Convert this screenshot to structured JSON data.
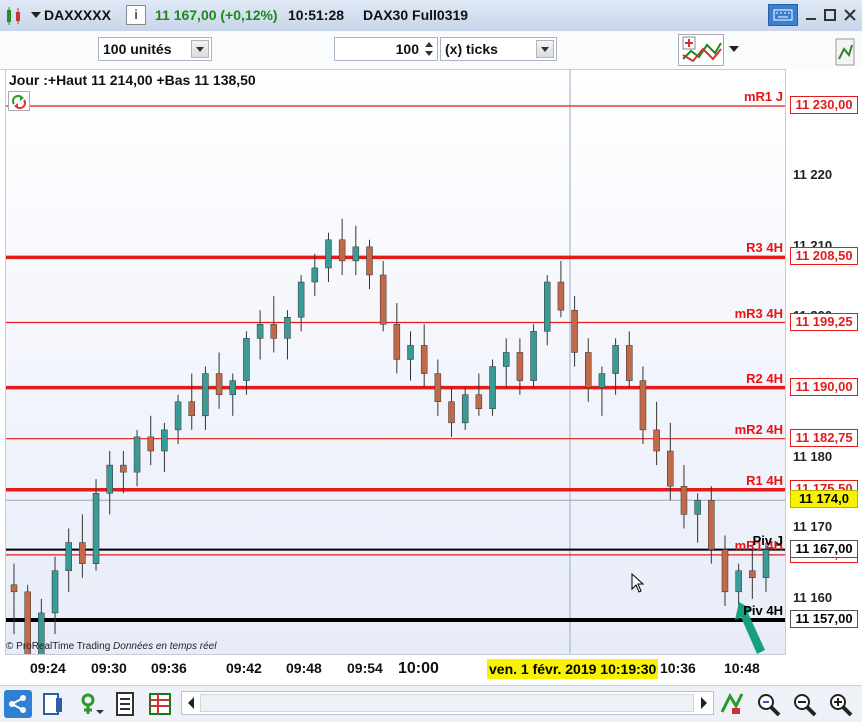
{
  "titlebar": {
    "instrument": "DAXXXXX",
    "info_icon": "i",
    "last_price": "11 167,00 (+0,12%)",
    "time": "10:51:28",
    "contract": "DAX30 Full0319"
  },
  "toolbar": {
    "units_value": "100 unités",
    "ticks_value": "100",
    "ticks_unit": "(x) ticks"
  },
  "chart": {
    "header": "Jour :+Haut 11 214,00 +Bas 11 138,50",
    "copyright": "© ProRealTime Trading",
    "realtime_note": "Données en temps réel",
    "cursor_time": "ven. 1 févr. 2019 10:19:30",
    "levels": [
      {
        "name": "mR1 J",
        "price_label": "11 230,00",
        "value": 11230.0,
        "weight": "thin"
      },
      {
        "name": "R3 4H",
        "price_label": "11 208,50",
        "value": 11208.5,
        "weight": "thick"
      },
      {
        "name": "mR3 4H",
        "price_label": "11 199,25",
        "value": 11199.25,
        "weight": "thin"
      },
      {
        "name": "R2 4H",
        "price_label": "11 190,00",
        "value": 11190.0,
        "weight": "thick"
      },
      {
        "name": "mR2 4H",
        "price_label": "11 182,75",
        "value": 11182.75,
        "weight": "thin"
      },
      {
        "name": "R1 4H",
        "price_label": "11 175,50",
        "value": 11175.5,
        "weight": "thick"
      },
      {
        "name": "mR1 4H",
        "price_label": "11 166,25",
        "value": 11166.25,
        "weight": "thin"
      },
      {
        "name": "Piv J",
        "price_label": "11 167,00",
        "value": 11167.0,
        "weight": "pivot"
      },
      {
        "name": "Piv 4H",
        "price_label": "11 157,00",
        "value": 11157.0,
        "weight": "pivot"
      }
    ],
    "current_price_label": "11 174,0",
    "y_ticks": [
      "11 220",
      "11 210",
      "11 200",
      "11 180",
      "11 170",
      "11 160"
    ],
    "x_ticks": [
      "09:24",
      "09:30",
      "09:36",
      "09:42",
      "09:48",
      "09:54",
      "10:00",
      "10:36",
      "10:48"
    ]
  },
  "chart_data": {
    "type": "candlestick",
    "series": [
      {
        "values": [
          [
            11162,
            11165,
            11155,
            11161
          ],
          [
            11161,
            11162,
            11151,
            11152
          ],
          [
            11152,
            11160,
            11149,
            11158
          ],
          [
            11158,
            11166,
            11155,
            11164
          ],
          [
            11164,
            11170,
            11161,
            11168
          ],
          [
            11168,
            11172,
            11163,
            11165
          ],
          [
            11165,
            11177,
            11164,
            11175
          ],
          [
            11175,
            11181,
            11172,
            11179
          ],
          [
            11179,
            11181,
            11175,
            11178
          ],
          [
            11178,
            11184,
            11176,
            11183
          ],
          [
            11183,
            11186,
            11179,
            11181
          ],
          [
            11181,
            11185,
            11178,
            11184
          ],
          [
            11184,
            11189,
            11182,
            11188
          ],
          [
            11188,
            11192,
            11184,
            11186
          ],
          [
            11186,
            11193,
            11184,
            11192
          ],
          [
            11192,
            11195,
            11187,
            11189
          ],
          [
            11189,
            11192,
            11186,
            11191
          ],
          [
            11191,
            11198,
            11189,
            11197
          ],
          [
            11197,
            11201,
            11194,
            11199
          ],
          [
            11199,
            11203,
            11195,
            11197
          ],
          [
            11197,
            11201,
            11194,
            11200
          ],
          [
            11200,
            11206,
            11198,
            11205
          ],
          [
            11205,
            11209,
            11203,
            11207
          ],
          [
            11207,
            11212,
            11205,
            11211
          ],
          [
            11211,
            11214,
            11206,
            11208
          ],
          [
            11208,
            11213,
            11206,
            11210
          ],
          [
            11210,
            11211,
            11204,
            11206
          ],
          [
            11206,
            11208,
            11198,
            11199
          ],
          [
            11199,
            11202,
            11192,
            11194
          ],
          [
            11194,
            11198,
            11191,
            11196
          ],
          [
            11196,
            11199,
            11190,
            11192
          ],
          [
            11192,
            11194,
            11186,
            11188
          ],
          [
            11188,
            11190,
            11183,
            11185
          ],
          [
            11185,
            11190,
            11184,
            11189
          ],
          [
            11189,
            11192,
            11186,
            11187
          ],
          [
            11187,
            11194,
            11186,
            11193
          ],
          [
            11193,
            11197,
            11190,
            11195
          ],
          [
            11195,
            11197,
            11189,
            11191
          ],
          [
            11191,
            11199,
            11190,
            11198
          ],
          [
            11198,
            11206,
            11196,
            11205
          ],
          [
            11205,
            11208,
            11200,
            11201
          ],
          [
            11201,
            11203,
            11193,
            11195
          ],
          [
            11195,
            11197,
            11188,
            11190
          ],
          [
            11190,
            11193,
            11186,
            11192
          ],
          [
            11192,
            11197,
            11189,
            11196
          ],
          [
            11196,
            11198,
            11190,
            11191
          ],
          [
            11191,
            11193,
            11182,
            11184
          ],
          [
            11184,
            11188,
            11179,
            11181
          ],
          [
            11181,
            11185,
            11174,
            11176
          ],
          [
            11176,
            11179,
            11170,
            11172
          ],
          [
            11172,
            11175,
            11168,
            11174
          ],
          [
            11174,
            11176,
            11165,
            11167
          ],
          [
            11167,
            11169,
            11159,
            11161
          ],
          [
            11161,
            11165,
            11157,
            11164
          ],
          [
            11164,
            11167,
            11160,
            11163
          ],
          [
            11163,
            11168,
            11161,
            11167
          ]
        ]
      }
    ],
    "ylim": [
      11150,
      11234
    ]
  },
  "bottombar": {
    "icons": [
      "share-icon",
      "layout-icon",
      "indicator-icon",
      "checklist-icon",
      "spreadsheet-icon",
      "scroll-left-icon",
      "scroll-right-icon",
      "draw-icon",
      "zoom-fit-icon",
      "zoom-out-icon",
      "zoom-in-icon"
    ]
  },
  "colors": {
    "up_candle": "#3a9a96",
    "down_candle": "#c2694a",
    "level_red": "#e31b1b",
    "pivot_black": "#000000",
    "current_price_bg": "#f6f200",
    "titlebar_green": "#1a8a1a"
  }
}
